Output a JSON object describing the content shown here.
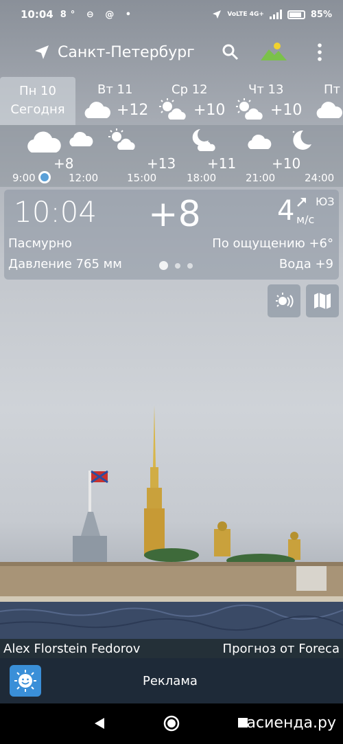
{
  "status_bar": {
    "time": "10:04",
    "left_icons": "8° ⊖ @ •",
    "network": "VoLTE 4G+",
    "battery": "85%"
  },
  "header": {
    "city": "Санкт-Петербург",
    "icons": [
      "location-arrow-icon",
      "search-icon",
      "landscape-icon",
      "more-vert-icon"
    ]
  },
  "days": [
    {
      "name": "Пн 10",
      "sub": "Сегодня",
      "selected": true
    },
    {
      "name": "Вт 11",
      "temp": "+12",
      "icon": "cloud-icon"
    },
    {
      "name": "Ср 12",
      "temp": "+10",
      "icon": "sun-cloud-icon"
    },
    {
      "name": "Чт 13",
      "temp": "+10",
      "icon": "sun-cloud-icon"
    },
    {
      "name": "Пт",
      "icon": "cloud-icon"
    }
  ],
  "hourly": {
    "temps": [
      "+8",
      "+13",
      "+11",
      "+10"
    ],
    "times": [
      "9:00",
      "12:00",
      "15:00",
      "18:00",
      "21:00",
      "24:00"
    ]
  },
  "current": {
    "time": "10:04",
    "temp": "+8",
    "wind_speed": "4",
    "wind_unit": "м/с",
    "wind_dir": "ЮЗ",
    "condition": "Пасмурно",
    "feels_like": "По ощущению +6°",
    "pressure": "Давление 765 мм",
    "water": "Вода +9"
  },
  "credits": {
    "photo_author": "Alex Florstein Fedorov",
    "forecast_source": "Прогноз от Foreca"
  },
  "ad": {
    "label": "Реклама"
  },
  "watermark": "асиенда.ру",
  "colors": {
    "accent": "#5aa0d8",
    "bottom_bar": "#1e2a38"
  }
}
